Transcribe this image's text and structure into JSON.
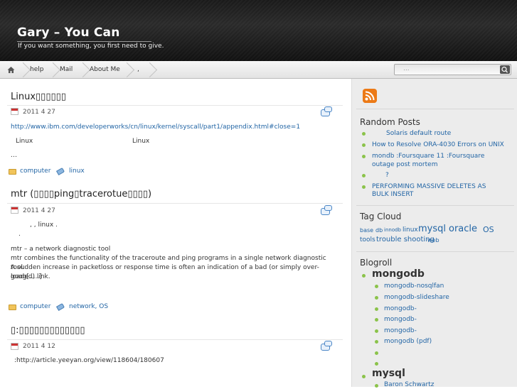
{
  "header": {
    "title": "Gary – You Can",
    "tagline": "If you want something, you first need to give."
  },
  "nav": {
    "items": [
      "help",
      "Mail",
      "About Me",
      ","
    ],
    "search_placeholder": "..."
  },
  "posts": [
    {
      "title": "Linux▯▯▯▯▯▯",
      "date": "2011 4 27",
      "link": "http://www.ibm.com/developerworks/cn/linux/kernel/syscall/part1/appendix.html#close=1",
      "line1a": "Linux",
      "line1b": "Linux",
      "excerpt_more": "…",
      "category": "computer",
      "tags": "linux"
    },
    {
      "title": "mtr (▯▯▯▯ping▯tracerotue▯▯▯▯)",
      "date": "2011 4 27",
      "intro1": ", ,  linux      .",
      "intro2": ".",
      "lines": [
        "mtr – a network diagnostic tool",
        "mtr combines the functionality of the traceroute and ping programs in a single network diagnostic tool.",
        "A sudden increase in packetloss or response time is often an indication of a bad (or simply over-loaded) link.",
        " goog[.....]"
      ],
      "category": "computer",
      "tags": "network, OS"
    },
    {
      "title": "▯:▯▯▯▯▯▯▯▯▯▯▯▯▯",
      "date": "2011 4 12",
      "line": ":http://article.yeeyan.org/view/118604/180607"
    }
  ],
  "sidebar": {
    "random_title": "Random Posts",
    "random": [
      "Solaris    default route",
      "How to Resolve ORA-4030 Errors on UNIX",
      "mondb  :Foursquare 11     :Foursquare",
      "outage post mortem",
      "?",
      "PERFORMING MASSIVE DELETES AS",
      "BULK INSERT"
    ],
    "tagcloud_title": "Tag Cloud",
    "tags": [
      "base",
      "db",
      "innodb",
      "linux",
      "mysql",
      "oracle",
      "OS",
      "tools",
      "trouble shooting",
      "web"
    ],
    "blogroll_title": "Blogroll",
    "mongodb": "mongodb",
    "mongodb_links": [
      "mongodb-nosqlfan",
      "mongodb-slideshare",
      "mongodb-",
      "mongodb-",
      "mongodb-",
      "mongodb  (pdf)",
      "",
      ""
    ],
    "mysql": "mysql",
    "mysql_links": [
      "Baron Schwartz"
    ]
  }
}
